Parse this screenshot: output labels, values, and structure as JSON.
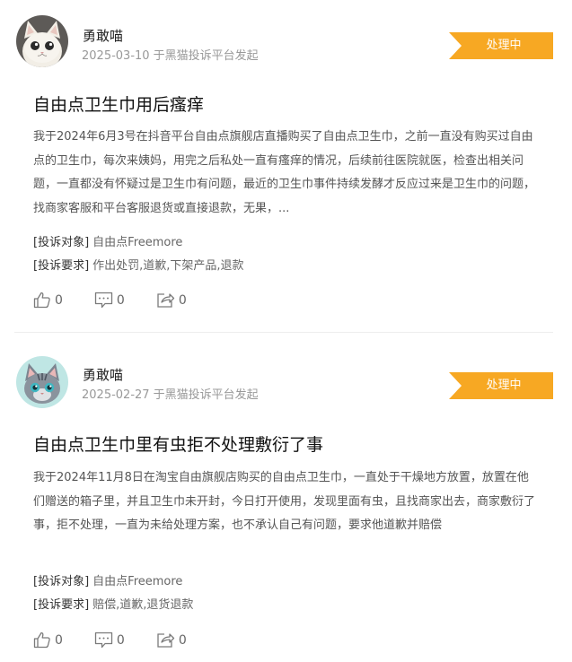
{
  "posts": [
    {
      "username": "勇敢喵",
      "meta": "2025-03-10 于黑猫投诉平台发起",
      "status": "处理中",
      "title": "自由点卫生巾用后瘙痒",
      "body": "我于2024年6月3号在抖音平台自由点旗舰店直播购买了自由点卫生巾，之前一直没有购买过自由点的卫生巾，每次来姨妈，用完之后私处一直有瘙痒的情况，后续前往医院就医，检查出相关问题，一直都没有怀疑过是卫生巾有问题，最近的卫生巾事件持续发酵才反应过来是卫生巾的问题，找商家客服和平台客服退货或直接退款，无果，...",
      "target_label": "[投诉对象]",
      "target_value": "自由点Freemore",
      "demand_label": "[投诉要求]",
      "demand_value": "作出处罚,道歉,下架产品,退款",
      "likes": "0",
      "comments": "0",
      "shares": "0"
    },
    {
      "username": "勇敢喵",
      "meta": "2025-02-27 于黑猫投诉平台发起",
      "status": "处理中",
      "title": "自由点卫生巾里有虫拒不处理敷衍了事",
      "body": "我于2024年11月8日在淘宝自由旗舰店购买的自由点卫生巾，一直处于干燥地方放置，放置在他们赠送的箱子里，并且卫生巾未开封，今日打开使用，发现里面有虫，且找商家出去，商家敷衍了事，拒不处理，一直为未给处理方案，也不承认自己有问题，要求他道歉并赔偿",
      "target_label": "[投诉对象]",
      "target_value": "自由点Freemore",
      "demand_label": "[投诉要求]",
      "demand_value": "赔偿,道歉,退货退款",
      "likes": "0",
      "comments": "0",
      "shares": "0"
    }
  ],
  "colors": {
    "badge": "#f7a823",
    "meta_text": "#999999",
    "divider": "#eeeeee"
  },
  "icons": {
    "like": "thumbs-up-icon",
    "comment": "comment-icon",
    "share": "share-icon",
    "avatar1": "white-cat-avatar",
    "avatar2": "gray-cat-avatar"
  }
}
